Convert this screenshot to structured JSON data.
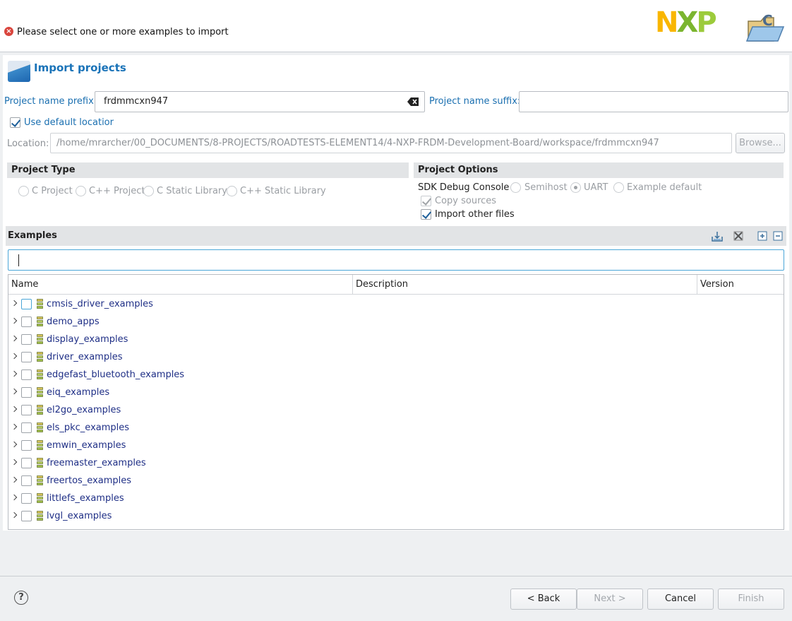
{
  "header": {
    "message": "Please select one or more examples to import",
    "message_icon": "error-icon",
    "logo_text": {
      "n": "N",
      "x": "X",
      "p": "P"
    },
    "brand_icon": "folder-wizard-icon"
  },
  "page": {
    "title": "Import projects",
    "title_icon": "import-wizard-icon"
  },
  "form": {
    "prefix_label": "Project name prefix:",
    "prefix_value": "frdmmcxn947",
    "suffix_label": "Project name suffix:",
    "suffix_value": "",
    "use_default_location_label": "Use default locatior",
    "use_default_location_checked": true,
    "location_label": "Location:",
    "location_value": "/home/mrarcher/00_DOCUMENTS/8-PROJECTS/ROADTESTS-ELEMENT14/4-NXP-FRDM-Development-Board/workspace/frdmmcxn947",
    "browse_label": "Browse..."
  },
  "project_type": {
    "heading": "Project Type",
    "options": [
      "C Project",
      "C++ Project",
      "C Static Library",
      "C++ Static Library"
    ]
  },
  "project_options": {
    "heading": "Project Options",
    "sdk_debug_label": "SDK Debug Console",
    "sdk_options": [
      "Semihost",
      "UART",
      "Example default"
    ],
    "sdk_selected": "UART",
    "copy_sources_label": "Copy sources",
    "copy_sources_checked": true,
    "import_other_label": "Import other files",
    "import_other_checked": true
  },
  "examples": {
    "heading": "Examples",
    "toolbar_icons": [
      "import-archive-icon",
      "clear-selection-icon",
      "expand-all-icon",
      "collapse-all-icon"
    ],
    "filter_value": "",
    "columns": [
      "Name",
      "Description",
      "Version"
    ],
    "rows": [
      "cmsis_driver_examples",
      "demo_apps",
      "display_examples",
      "driver_examples",
      "edgefast_bluetooth_examples",
      "eiq_examples",
      "el2go_examples",
      "els_pkc_examples",
      "emwin_examples",
      "freemaster_examples",
      "freertos_examples",
      "littlefs_examples",
      "lvgl_examples"
    ]
  },
  "footer": {
    "help_icon": "help-icon",
    "help_glyph": "?",
    "back_label": "< Back",
    "next_label": "Next >",
    "cancel_label": "Cancel",
    "finish_label": "Finish"
  },
  "colors": {
    "accent": "#1a73b8",
    "link_label": "#1a6fb0",
    "tree_item": "#1f2f86",
    "filter_border": "#4aa6d8",
    "error": "#d9453d",
    "nxp_yellow": "#f9b600",
    "nxp_green": "#7bb52f"
  }
}
